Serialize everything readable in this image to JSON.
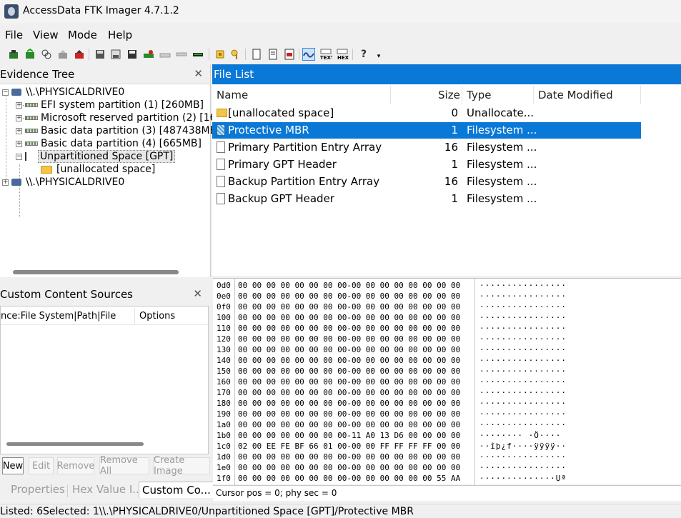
{
  "window": {
    "title": "AccessData FTK Imager 4.7.1.2"
  },
  "menu": {
    "items": [
      "File",
      "View",
      "Mode",
      "Help"
    ]
  },
  "evidence_tree": {
    "title": "Evidence Tree",
    "nodes": [
      "\\\\.\\PHYSICALDRIVE0",
      "EFI system partition (1) [260MB]",
      "Microsoft reserved partition (2) [16M",
      "Basic data partition (3) [487438MB",
      "Basic data partition (4) [665MB]",
      "Unpartitioned Space [GPT]",
      "[unallocated space]",
      "\\\\.\\PHYSICALDRIVE0"
    ]
  },
  "custom_sources": {
    "title": "Custom Content Sources",
    "columns": [
      "nce:File System|Path|File",
      "Options"
    ],
    "buttons": [
      "New",
      "Edit",
      "Remove",
      "Remove All",
      "Create Image"
    ]
  },
  "bottom_tabs": [
    "Properties",
    "Hex Value I...",
    "Custom Co..."
  ],
  "file_list": {
    "title": "File List",
    "columns": [
      "Name",
      "Size",
      "Type",
      "Date Modified"
    ],
    "rows": [
      {
        "name": "[unallocated space]",
        "size": "0",
        "type": "Unallocate...",
        "icon": "folder"
      },
      {
        "name": "Protective MBR",
        "size": "1",
        "type": "Filesystem ...",
        "icon": "mbr"
      },
      {
        "name": "Primary Partition Entry Array",
        "size": "16",
        "type": "Filesystem ...",
        "icon": "file"
      },
      {
        "name": "Primary GPT Header",
        "size": "1",
        "type": "Filesystem ...",
        "icon": "file"
      },
      {
        "name": "Backup Partition Entry Array",
        "size": "16",
        "type": "Filesystem ...",
        "icon": "file"
      },
      {
        "name": "Backup GPT Header",
        "size": "1",
        "type": "Filesystem ...",
        "icon": "file"
      }
    ],
    "selected_index": 1
  },
  "hex": {
    "rows": [
      {
        "off": "0d0",
        "bytes": "00 00 00 00 00 00 00 00-00 00 00 00 00 00 00 00",
        "ascii": "················"
      },
      {
        "off": "0e0",
        "bytes": "00 00 00 00 00 00 00 00-00 00 00 00 00 00 00 00",
        "ascii": "················"
      },
      {
        "off": "0f0",
        "bytes": "00 00 00 00 00 00 00 00-00 00 00 00 00 00 00 00",
        "ascii": "················"
      },
      {
        "off": "100",
        "bytes": "00 00 00 00 00 00 00 00-00 00 00 00 00 00 00 00",
        "ascii": "················"
      },
      {
        "off": "110",
        "bytes": "00 00 00 00 00 00 00 00-00 00 00 00 00 00 00 00",
        "ascii": "················"
      },
      {
        "off": "120",
        "bytes": "00 00 00 00 00 00 00 00-00 00 00 00 00 00 00 00",
        "ascii": "················"
      },
      {
        "off": "130",
        "bytes": "00 00 00 00 00 00 00 00-00 00 00 00 00 00 00 00",
        "ascii": "················"
      },
      {
        "off": "140",
        "bytes": "00 00 00 00 00 00 00 00-00 00 00 00 00 00 00 00",
        "ascii": "················"
      },
      {
        "off": "150",
        "bytes": "00 00 00 00 00 00 00 00-00 00 00 00 00 00 00 00",
        "ascii": "················"
      },
      {
        "off": "160",
        "bytes": "00 00 00 00 00 00 00 00-00 00 00 00 00 00 00 00",
        "ascii": "················"
      },
      {
        "off": "170",
        "bytes": "00 00 00 00 00 00 00 00-00 00 00 00 00 00 00 00",
        "ascii": "················"
      },
      {
        "off": "180",
        "bytes": "00 00 00 00 00 00 00 00-00 00 00 00 00 00 00 00",
        "ascii": "················"
      },
      {
        "off": "190",
        "bytes": "00 00 00 00 00 00 00 00-00 00 00 00 00 00 00 00",
        "ascii": "················"
      },
      {
        "off": "1a0",
        "bytes": "00 00 00 00 00 00 00 00-00 00 00 00 00 00 00 00",
        "ascii": "················"
      },
      {
        "off": "1b0",
        "bytes": "00 00 00 00 00 00 00 00-11 A0 13 D6 00 00 00 00",
        "ascii": "········ ·Ö····"
      },
      {
        "off": "1c0",
        "bytes": "02 00 EE FE BF 66 01 00-00 00 FF FF FF FF 00 00",
        "ascii": "··îþ¿f····ÿÿÿÿ··"
      },
      {
        "off": "1d0",
        "bytes": "00 00 00 00 00 00 00 00-00 00 00 00 00 00 00 00",
        "ascii": "················"
      },
      {
        "off": "1e0",
        "bytes": "00 00 00 00 00 00 00 00-00 00 00 00 00 00 00 00",
        "ascii": "················"
      },
      {
        "off": "1f0",
        "bytes": "00 00 00 00 00 00 00 00-00 00 00 00 00 00 55 AA",
        "ascii": "··············Uª"
      }
    ],
    "cursor": "Cursor pos = 0; phy sec = 0"
  },
  "status": "Listed: 6Selected: 1\\\\.\\PHYSICALDRIVE0/Unpartitioned Space [GPT]/Protective MBR"
}
